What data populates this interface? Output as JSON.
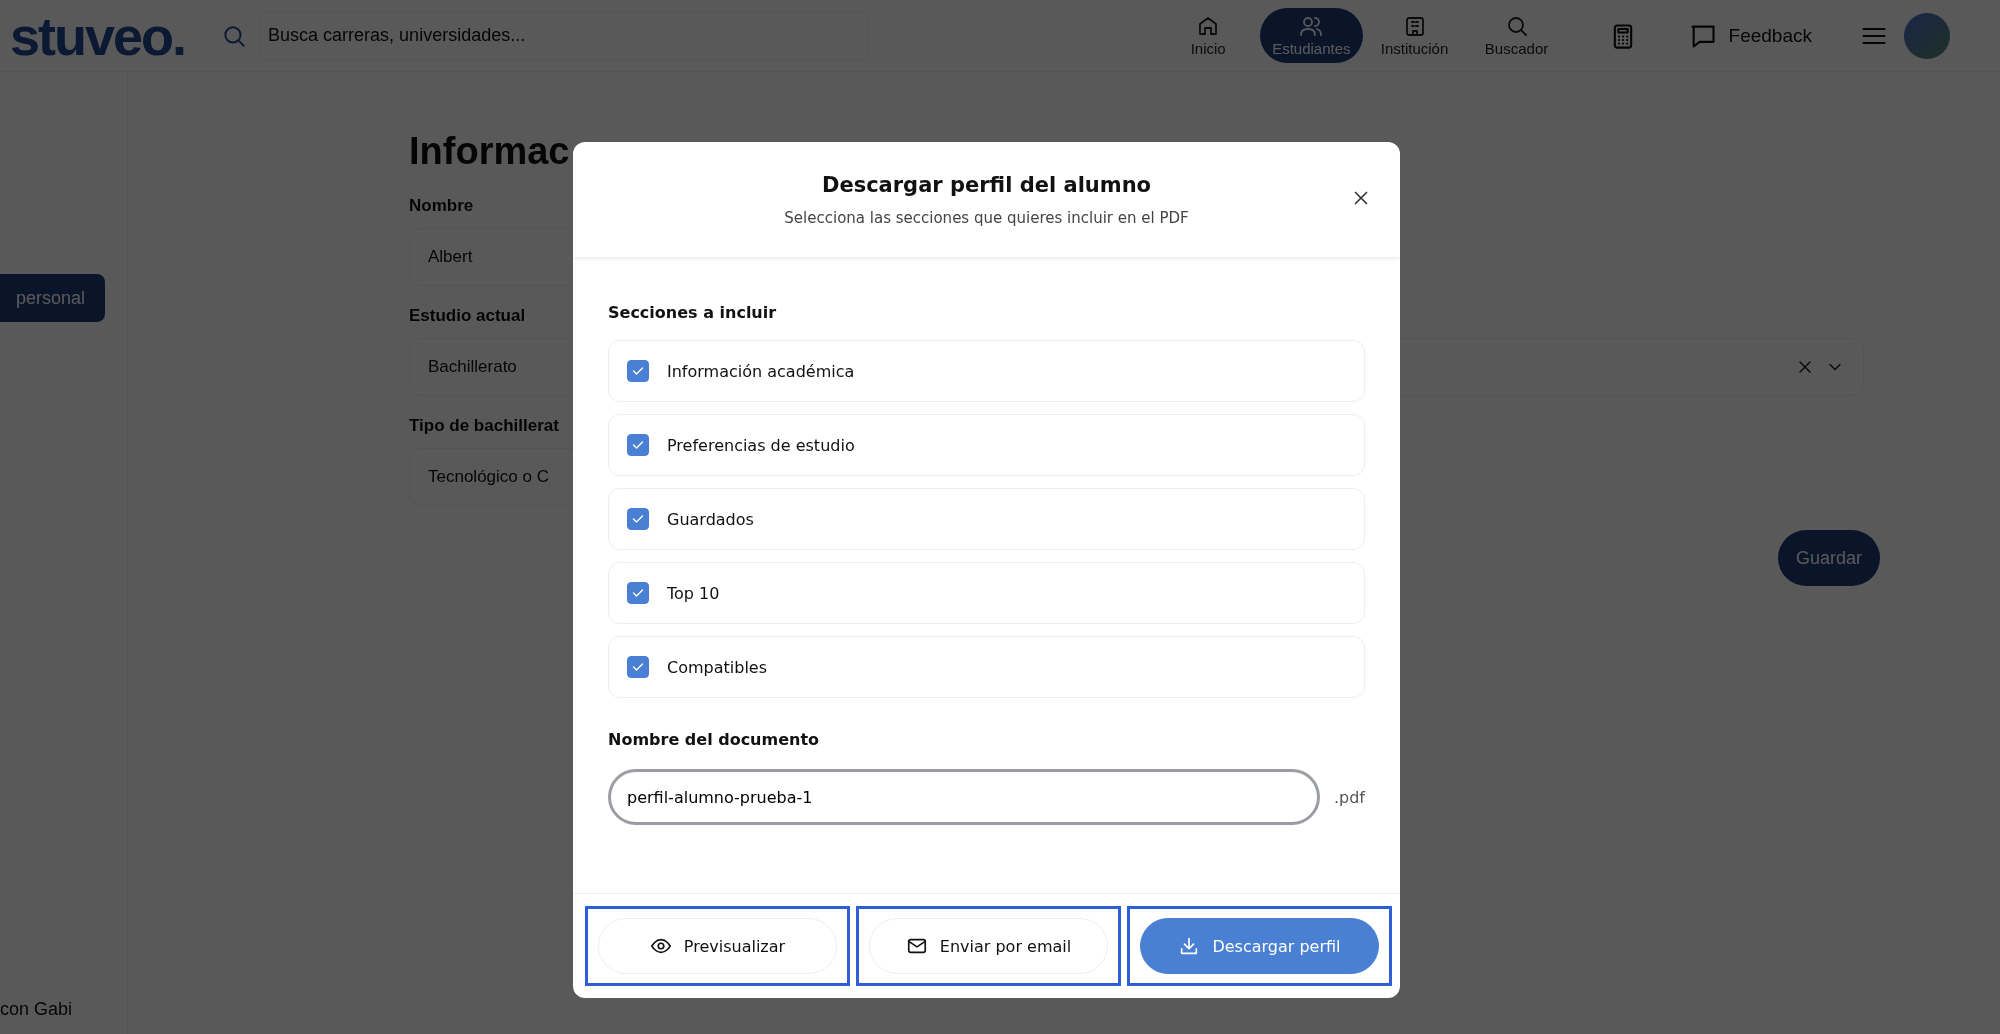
{
  "header": {
    "logo": "stuveo.",
    "search": {
      "placeholder": "Busca carreras, universidades..."
    },
    "nav": [
      {
        "label": "Inicio",
        "selected": false
      },
      {
        "label": "Estudiantes",
        "selected": true
      },
      {
        "label": "Institución",
        "selected": false
      },
      {
        "label": "Buscador",
        "selected": false
      }
    ],
    "feedback": "Feedback"
  },
  "sidebar": {
    "items": [
      {
        "label": "personal",
        "selected": true
      }
    ],
    "footer_item": "con Gabi"
  },
  "form": {
    "title": "Informac",
    "fields": [
      {
        "label": "Nombre",
        "value": "Albert",
        "kind": "text"
      },
      {
        "label": "Estudio actual",
        "value": "Bachillerato",
        "kind": "select"
      },
      {
        "label": "Tipo de bachillerat",
        "value": "Tecnológico o C",
        "kind": "text"
      }
    ],
    "save": "Guardar"
  },
  "modal": {
    "title": "Descargar perfil del alumno",
    "subtitle": "Selecciona las secciones que quieres incluir en el PDF",
    "sections_label": "Secciones a incluir",
    "sections": [
      {
        "label": "Información académica",
        "checked": true
      },
      {
        "label": "Preferencias de estudio",
        "checked": true
      },
      {
        "label": "Guardados",
        "checked": true
      },
      {
        "label": "Top 10",
        "checked": true
      },
      {
        "label": "Compatibles",
        "checked": true
      }
    ],
    "filename_label": "Nombre del documento",
    "filename": "perfil-alumno-prueba-1",
    "extension": ".pdf",
    "buttons": [
      {
        "label": "Previsualizar",
        "kind": "secondary",
        "highlighted": true
      },
      {
        "label": "Enviar por email",
        "kind": "secondary",
        "highlighted": true
      },
      {
        "label": "Descargar perfil",
        "kind": "primary",
        "highlighted": true
      }
    ]
  }
}
